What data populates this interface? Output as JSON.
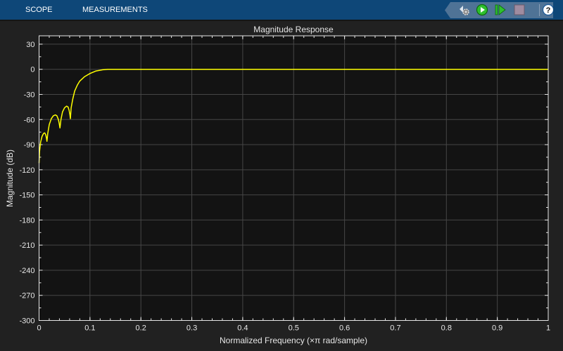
{
  "toolbar": {
    "tabs": [
      {
        "label": "SCOPE"
      },
      {
        "label": "MEASUREMENTS"
      }
    ],
    "buttons": [
      {
        "name": "settings-icon"
      },
      {
        "name": "run-icon"
      },
      {
        "name": "step-forward-icon"
      },
      {
        "name": "stop-icon"
      },
      {
        "name": "help-icon",
        "label": "?"
      }
    ]
  },
  "colors": {
    "accent": "#ffff00",
    "topbar": "#0e4778",
    "plot_bg": "#131313",
    "grid": "#464646"
  },
  "chart_data": {
    "type": "line",
    "title": "Magnitude Response",
    "xlabel": "Normalized Frequency (×π rad/sample)",
    "ylabel": "Magnitude (dB)",
    "xlim": [
      0,
      1
    ],
    "ylim": [
      -300,
      40
    ],
    "grid": true,
    "xticks": [
      0,
      0.1,
      0.2,
      0.3,
      0.4,
      0.5,
      0.6,
      0.7,
      0.8,
      0.9,
      1
    ],
    "xtick_labels": [
      "0",
      "0.1",
      "0.2",
      "0.3",
      "0.4",
      "0.5",
      "0.6",
      "0.7",
      "0.8",
      "0.9",
      "1"
    ],
    "yticks": [
      30,
      0,
      -30,
      -60,
      -90,
      -120,
      -150,
      -180,
      -210,
      -240,
      -270,
      -300
    ],
    "ytick_labels": [
      "30",
      "0",
      "-30",
      "-60",
      "-90",
      "-120",
      "-150",
      "-180",
      "-210",
      "-240",
      "-270",
      "-300"
    ],
    "series": [
      {
        "name": "Magnitude",
        "color": "#ffff00",
        "x": [
          0,
          0.001,
          0.003,
          0.006,
          0.009,
          0.011,
          0.013,
          0.0145,
          0.0155,
          0.017,
          0.02,
          0.024,
          0.028,
          0.032,
          0.035,
          0.038,
          0.04,
          0.041,
          0.043,
          0.046,
          0.05,
          0.054,
          0.057,
          0.059,
          0.0605,
          0.0615,
          0.063,
          0.066,
          0.07,
          0.075,
          0.08,
          0.089,
          0.1,
          0.112,
          0.125,
          0.135,
          0.15,
          1
        ],
        "y": [
          -112,
          -98,
          -87,
          -80,
          -76.5,
          -76,
          -78,
          -82,
          -86,
          -77,
          -66,
          -59,
          -55.5,
          -54.5,
          -55.5,
          -60,
          -66,
          -70,
          -60,
          -51,
          -46,
          -44,
          -45,
          -49,
          -54,
          -59,
          -46,
          -36,
          -26,
          -19,
          -14,
          -9,
          -5,
          -2,
          -0.6,
          0,
          0,
          0
        ]
      }
    ]
  }
}
